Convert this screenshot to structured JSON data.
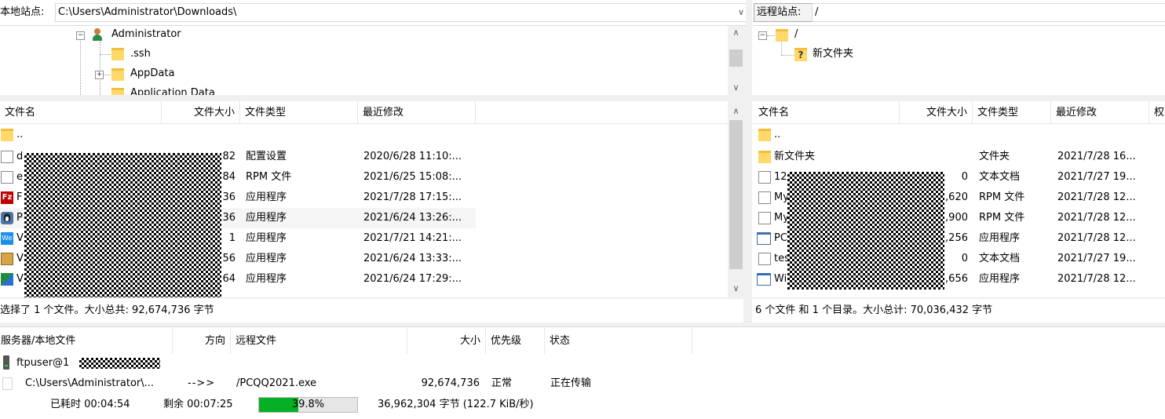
{
  "local": {
    "site_label": "本地站点:",
    "path": "C:\\Users\\Administrator\\Downloads\\",
    "tree": [
      {
        "name": "Administrator",
        "icon": "user-folder-icon"
      },
      {
        "name": ".ssh",
        "icon": "folder-icon"
      },
      {
        "name": "AppData",
        "icon": "folder-icon"
      },
      {
        "name": "Application Data",
        "icon": "folder-icon"
      }
    ],
    "columns": [
      "文件名",
      "文件大小",
      "文件类型",
      "最近修改"
    ],
    "files": [
      {
        "name": "..",
        "size": "",
        "type": "",
        "modified": "",
        "icon": "folder-icon"
      },
      {
        "name": "d",
        "size": "82",
        "type": "配置设置",
        "modified": "2020/6/28 11:10:...",
        "icon": "config-file-icon"
      },
      {
        "name": "e",
        "size": "84",
        "type": "RPM 文件",
        "modified": "2021/6/25 15:08:...",
        "icon": "file-icon"
      },
      {
        "name": "F",
        "size": "36",
        "type": "应用程序",
        "modified": "2021/7/28 17:15:...",
        "icon": "filezilla-app-icon"
      },
      {
        "name": "P",
        "size": "36",
        "type": "应用程序",
        "modified": "2021/6/24 13:26:...",
        "icon": "penguin-app-icon"
      },
      {
        "name": "V",
        "size": "1",
        "type": "应用程序",
        "modified": "2021/7/21 14:21:...",
        "icon": "wechat-app-icon"
      },
      {
        "name": "V",
        "size": "56",
        "type": "应用程序",
        "modified": "2021/6/24 13:33:...",
        "icon": "installer-app-icon"
      },
      {
        "name": "V",
        "size": "64",
        "type": "应用程序",
        "modified": "2021/6/24 17:29:...",
        "icon": "app-icon"
      }
    ],
    "status": "选择了 1 个文件。大小总共: 92,674,736 字节"
  },
  "remote": {
    "site_label": "远程站点:",
    "path": "/",
    "tree": [
      {
        "name": "/",
        "icon": "folder-icon"
      },
      {
        "name": "新文件夹",
        "icon": "unknown-folder-icon"
      }
    ],
    "columns": [
      "文件名",
      "文件大小",
      "文件类型",
      "最近修改",
      "权"
    ],
    "files": [
      {
        "name": "..",
        "size": "",
        "type": "",
        "modified": "",
        "icon": "folder-icon"
      },
      {
        "name": "新文件夹",
        "size": "",
        "type": "文件夹",
        "modified": "2021/7/28 16...",
        "icon": "folder-icon"
      },
      {
        "name": "12",
        "size": "0",
        "type": "文本文档",
        "modified": "2021/7/27 19...",
        "icon": "text-file-icon"
      },
      {
        "name": "My",
        "size": ",620",
        "type": "RPM 文件",
        "modified": "2021/7/28 12...",
        "icon": "file-icon"
      },
      {
        "name": "My",
        "size": ",900",
        "type": "RPM 文件",
        "modified": "2021/7/28 12...",
        "icon": "file-icon"
      },
      {
        "name": "PC",
        "size": ",256",
        "type": "应用程序",
        "modified": "2021/7/28 12...",
        "icon": "app-window-icon"
      },
      {
        "name": "tes",
        "size": "0",
        "type": "文本文档",
        "modified": "2021/7/27 19...",
        "icon": "text-file-icon"
      },
      {
        "name": "Wi",
        "size": ",656",
        "type": "应用程序",
        "modified": "2021/7/28 12...",
        "icon": "app-window-icon"
      }
    ],
    "status": "6 个文件 和 1 个目录。大小总计: 70,036,432 字节"
  },
  "queue": {
    "columns": [
      "服务器/本地文件",
      "方向",
      "远程文件",
      "大小",
      "优先级",
      "状态"
    ],
    "server": "ftpuser@1",
    "transfer": {
      "local_file": "C:\\Users\\Administrator\\...",
      "direction": "-->>",
      "remote_file": "/PCQQ2021.exe",
      "size": "92,674,736",
      "priority": "正常",
      "state": "正在传输"
    },
    "elapsed": "已耗时 00:04:54",
    "remaining": "剩余 00:07:25",
    "progress_text": "39.8%",
    "progress_fraction": 0.398,
    "bytes_text": "36,962,304 字节 (122.7 KiB/秒)"
  },
  "colors": {
    "progress": "#06b025",
    "selected_row": "#f5f5f5"
  }
}
